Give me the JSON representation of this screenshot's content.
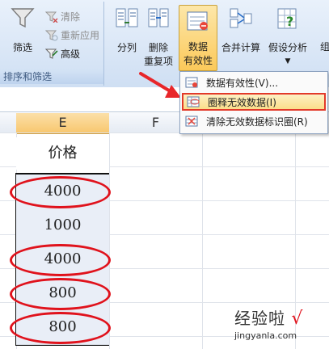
{
  "ribbon": {
    "sort_filter": {
      "filter_label": "筛选",
      "clear_label": "清除",
      "reapply_label": "重新应用",
      "advanced_label": "高级",
      "group_label": "排序和筛选"
    },
    "data_tools": {
      "split_label": "分列",
      "remove_dup_label_1": "删除",
      "remove_dup_label_2": "重复项",
      "validation_label_1": "数据",
      "validation_label_2": "有效性",
      "consolidate_label": "合并计算",
      "whatif_label": "假设分析",
      "group_partial_label": "组"
    }
  },
  "dropdown": {
    "items": [
      {
        "label": "数据有效性(V)..."
      },
      {
        "label": "圈释无效数据(I)"
      },
      {
        "label": "清除无效数据标识圈(R)"
      }
    ]
  },
  "sheet": {
    "columns": [
      "E",
      "F"
    ],
    "header_value": "价格",
    "values": [
      "4000",
      "1000",
      "4000",
      "800",
      "800"
    ]
  },
  "watermark": {
    "text": "经验啦",
    "url": "jingyanla.com",
    "check": "√"
  },
  "colors": {
    "accent_red": "#e0121c",
    "ribbon_bg": "#dbe7f6",
    "selected_header": "#f8c870"
  }
}
